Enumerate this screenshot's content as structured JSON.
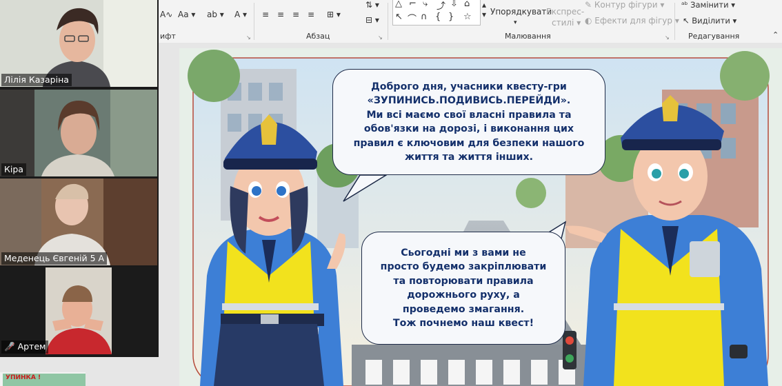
{
  "ribbon": {
    "font_group_label": "ифт",
    "paragraph_group_label": "Абзац",
    "drawing_group_label": "Малювання",
    "editing_group_label": "Редагування",
    "arrange_label": "Упорядкувати",
    "quick_styles_label_1": "Експрес-",
    "quick_styles_label_2": "стилі",
    "shape_outline_label": "Контур фігури",
    "shape_effects_label": "Ефекти для фігур",
    "replace_label": "Замінити",
    "select_label": "Виділити",
    "font_case_label": "Aa"
  },
  "participants": [
    {
      "name": "Лілія Казаріна",
      "muted": false,
      "active": true
    },
    {
      "name": "Кіра",
      "muted": false,
      "active": false
    },
    {
      "name": "Меденець Євгеній 5 А",
      "muted": false,
      "active": false
    },
    {
      "name": "Артем",
      "muted": true,
      "active": false
    }
  ],
  "slide": {
    "bubble_top_lines": [
      "Доброго дня, учасники квесту-гри",
      "«ЗУПИНИСЬ.ПОДИВИСЬ.ПЕРЕЙДИ».",
      "Ми всі маємо свої власні правила та",
      "обов'язки на дорозі, і виконання цих",
      "правил є ключовим для безпеки нашого",
      "життя та життя інших."
    ],
    "bubble_bottom_lines": [
      "Сьогодні ми з вами не",
      "просто будемо закріплювати",
      "та повторювати правила",
      "дорожнього руху, а",
      "проведемо змагання.",
      "Тож почнемо наш квест!"
    ]
  },
  "thumbnail_next": {
    "text": "УПИНКА !"
  }
}
